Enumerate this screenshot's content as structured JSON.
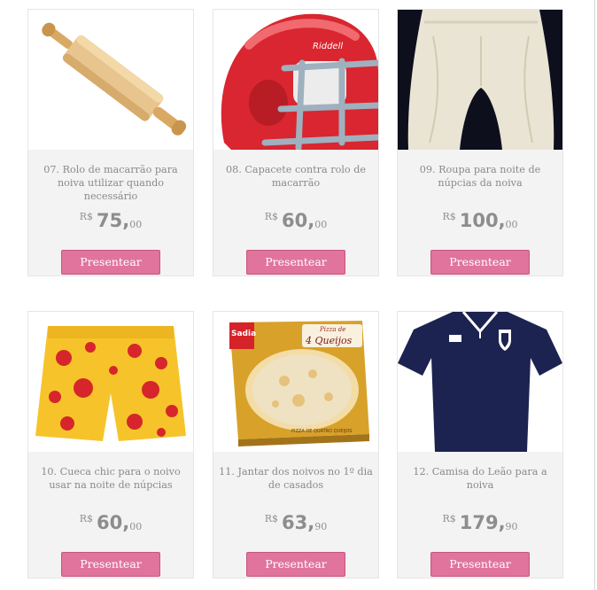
{
  "currency_symbol": "R$",
  "button_label": "Presentear",
  "colors": {
    "button": "#e0749c",
    "card_bg": "#f3f3f3",
    "text": "#8a8a8a"
  },
  "gifts": [
    {
      "title": "07. Rolo de macarrão para noiva utilizar quando necessário",
      "price_int": "75",
      "price_cents": "00",
      "image": "rolling-pin-image"
    },
    {
      "title": "08. Capacete contra rolo de macarrão",
      "price_int": "60",
      "price_cents": "00",
      "image": "football-helmet-image"
    },
    {
      "title": "09. Roupa para noite de núpcias da noiva",
      "price_int": "100",
      "price_cents": "00",
      "image": "bloomers-image"
    },
    {
      "title": "10. Cueca chic para o noivo usar na noite de núpcias",
      "price_int": "60",
      "price_cents": "00",
      "image": "polka-dot-boxers-image"
    },
    {
      "title": "11. Jantar dos noivos no 1º dia de casados",
      "price_int": "63",
      "price_cents": "90",
      "image": "frozen-pizza-box-image"
    },
    {
      "title": "12. Camisa do Leão para a noiva",
      "price_int": "179",
      "price_cents": "90",
      "image": "soccer-jersey-image"
    }
  ],
  "product_image_text": {
    "helmet_brand": "Riddell",
    "pizza_brand": "Sadia",
    "pizza_label_top": "Pizza de",
    "pizza_label_main": "4 Queijos",
    "pizza_box_footer": "PIZZA DE QUATRO QUEIJOS"
  }
}
